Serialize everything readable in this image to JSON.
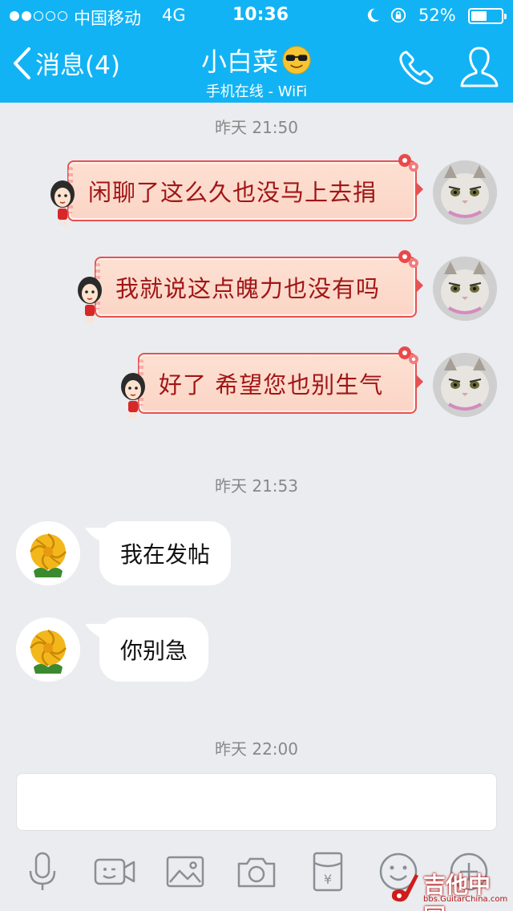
{
  "status_bar": {
    "carrier": "中国移动",
    "network": "4G",
    "time": "10:36",
    "battery_percent": "52%",
    "battery_level": 0.52,
    "signal_dots_filled": 2,
    "signal_dots_total": 5
  },
  "nav": {
    "back_label": "消息(4)",
    "contact_name": "小白菜",
    "contact_status": "手机在线 - WiFi",
    "back_icon": "chevron-left-icon",
    "call_icon": "phone-icon",
    "profile_icon": "person-icon"
  },
  "messages": {
    "time1": "昨天 21:50",
    "out": [
      {
        "text": "闲聊了这么久也没马上去捐"
      },
      {
        "text": "我就说这点魄力也没有吗"
      },
      {
        "text": "好了 希望您也别生气"
      }
    ],
    "time2": "昨天 21:53",
    "in": [
      {
        "text": "我在发帖"
      },
      {
        "text": "你别急"
      }
    ],
    "time3": "昨天 22:00"
  },
  "toolbar": {
    "icons": [
      "microphone-icon",
      "video-call-icon",
      "image-icon",
      "camera-icon",
      "red-packet-icon",
      "emoji-icon",
      "plus-icon"
    ],
    "red_packet_symbol": "¥"
  },
  "watermark": {
    "text": "吉他中国",
    "sub": "bbs.GuitarChina.com"
  },
  "colors": {
    "header_blue": "#12b3f4",
    "background": "#eaecef",
    "out_bubble_border": "#e85151",
    "out_text": "#a01616"
  }
}
